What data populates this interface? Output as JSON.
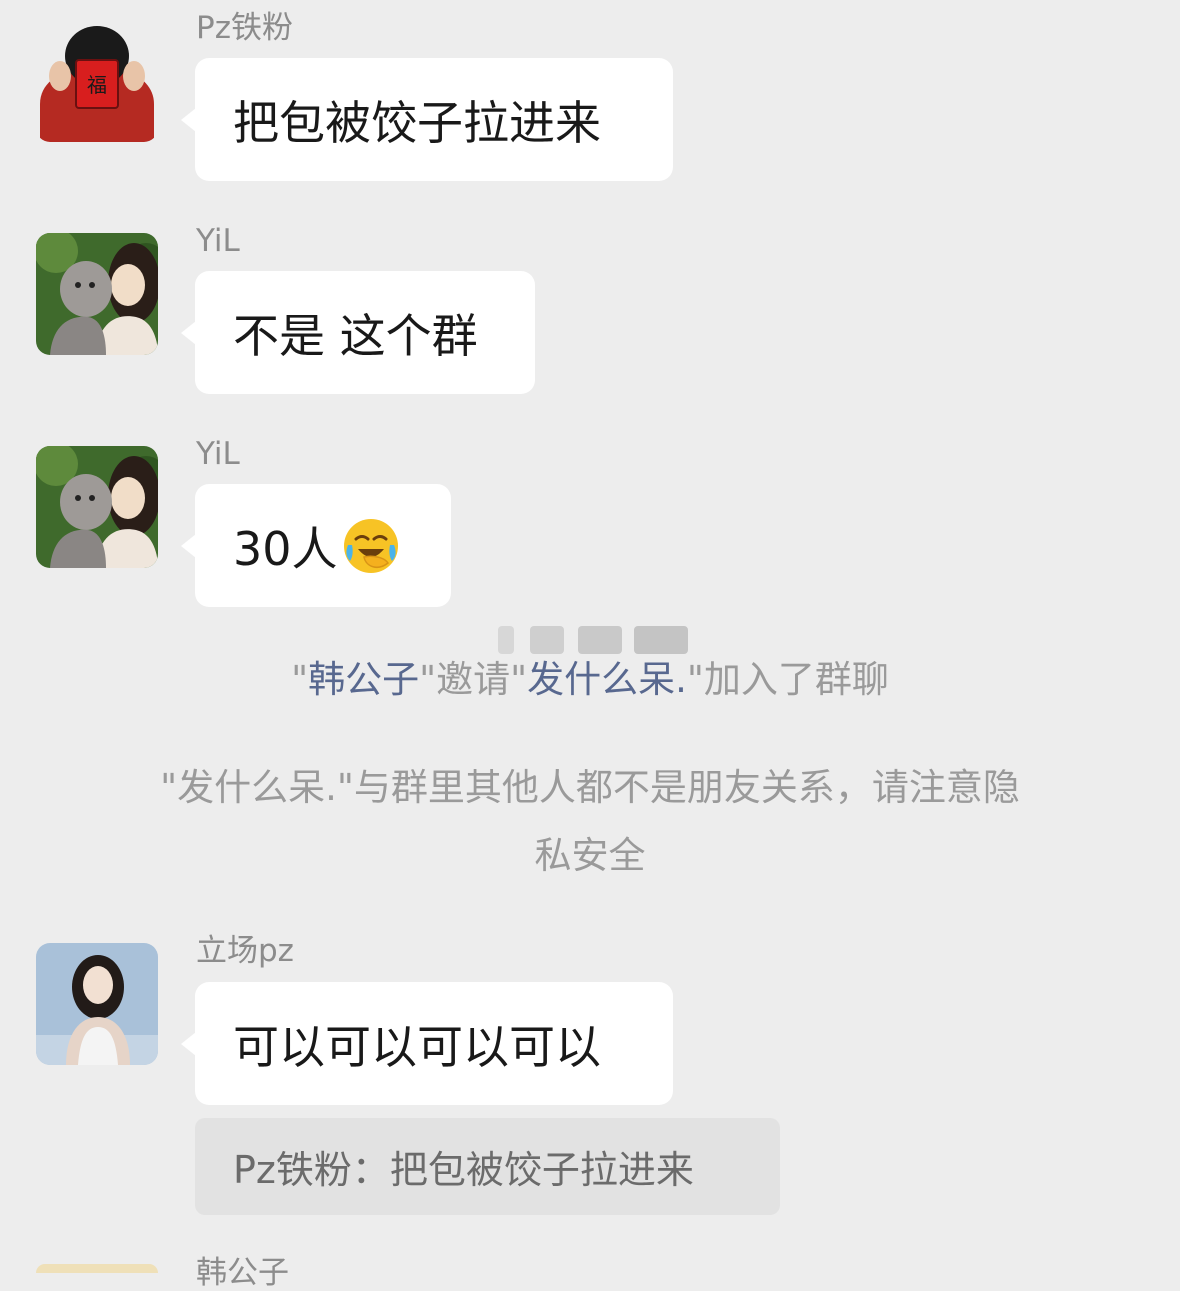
{
  "messages": [
    {
      "sender": "Pz铁粉",
      "text": "把包被饺子拉进来"
    },
    {
      "sender": "YiL",
      "text": "不是 这个群"
    },
    {
      "sender": "YiL",
      "text": "30人",
      "emoji": "face-with-tears-of-joy"
    },
    {
      "sender": "立场pz",
      "text": "可以可以可以可以"
    }
  ],
  "system": {
    "invite": {
      "q1": "\"",
      "inviter": "韩公子",
      "mid": "\"邀请\"",
      "invitee": "发什么呆.",
      "tail": "\"加入了群聊"
    },
    "privacy_line1": "\"发什么呆.\"与群里其他人都不是朋友关系，请注意隐",
    "privacy_line2": "私安全"
  },
  "quote": {
    "text": "Pz铁粉：把包被饺子拉进来"
  },
  "next_sender": "韩公子",
  "colors": {
    "background": "#ededed",
    "bubble": "#ffffff",
    "highlight_name": "#58688f",
    "system_text": "#9a9a9a",
    "quote_bg": "#e2e2e2"
  }
}
